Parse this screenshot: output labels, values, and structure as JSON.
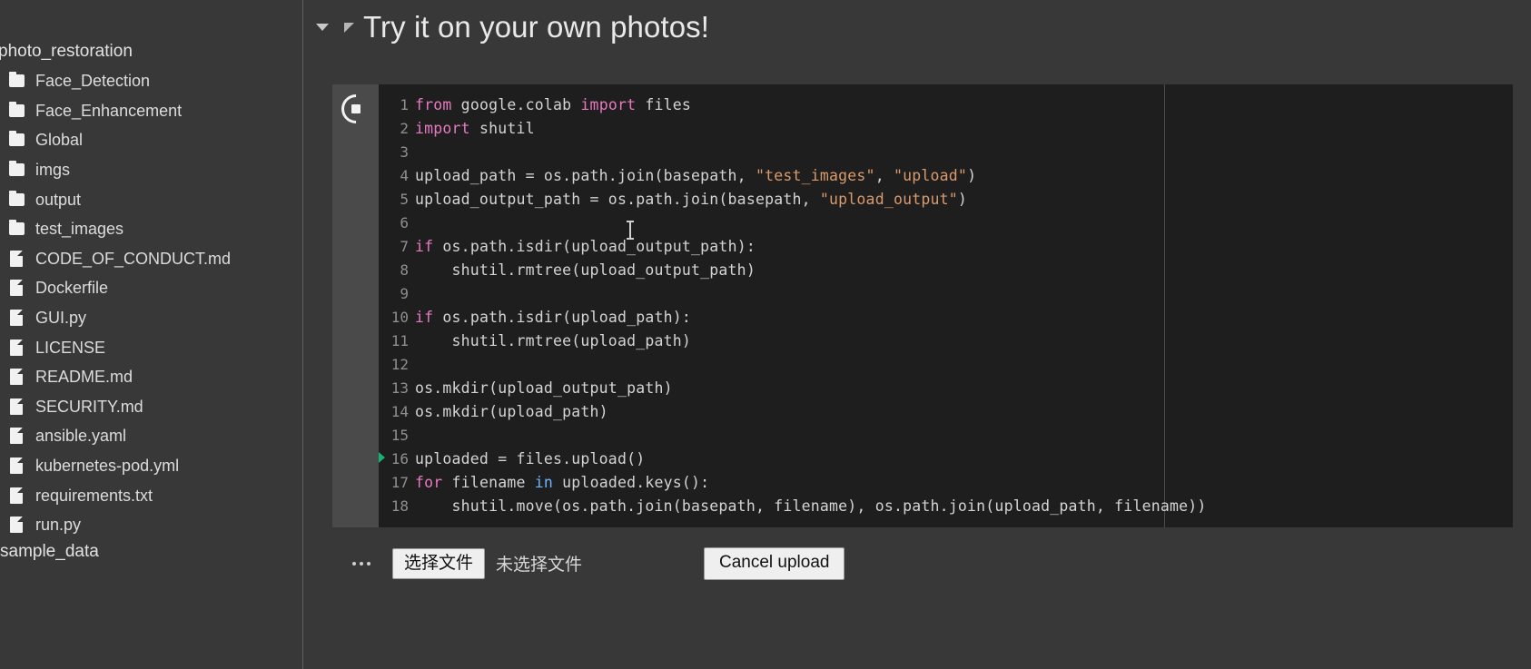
{
  "sidebar": {
    "root_label": "photo_restoration",
    "root_icon": "folder-icon",
    "items": [
      {
        "name": "Face_Detection",
        "type": "folder"
      },
      {
        "name": "Face_Enhancement",
        "type": "folder"
      },
      {
        "name": "Global",
        "type": "folder"
      },
      {
        "name": "imgs",
        "type": "folder"
      },
      {
        "name": "output",
        "type": "folder"
      },
      {
        "name": "test_images",
        "type": "folder"
      },
      {
        "name": "CODE_OF_CONDUCT.md",
        "type": "file"
      },
      {
        "name": "Dockerfile",
        "type": "file"
      },
      {
        "name": "GUI.py",
        "type": "file"
      },
      {
        "name": "LICENSE",
        "type": "file"
      },
      {
        "name": "README.md",
        "type": "file"
      },
      {
        "name": "SECURITY.md",
        "type": "file"
      },
      {
        "name": "ansible.yaml",
        "type": "file"
      },
      {
        "name": "kubernetes-pod.yml",
        "type": "file"
      },
      {
        "name": "requirements.txt",
        "type": "file"
      },
      {
        "name": "run.py",
        "type": "file"
      }
    ],
    "footer_label": "sample_data"
  },
  "notebook": {
    "section_title": "Try it on your own photos!",
    "collapse_icon": "chevron-down-icon",
    "section_marker_icon": "section-triangle-icon",
    "cell": {
      "status_icon": "running-spinner-stop-icon",
      "executing_line": 16,
      "lines": [
        {
          "n": 1,
          "tokens": [
            {
              "t": "from",
              "c": "kw"
            },
            {
              "t": " google.colab ",
              "c": "plain"
            },
            {
              "t": "import",
              "c": "kw"
            },
            {
              "t": " files",
              "c": "plain"
            }
          ]
        },
        {
          "n": 2,
          "tokens": [
            {
              "t": "import",
              "c": "kw"
            },
            {
              "t": " shutil",
              "c": "plain"
            }
          ]
        },
        {
          "n": 3,
          "tokens": [
            {
              "t": "",
              "c": "plain"
            }
          ]
        },
        {
          "n": 4,
          "tokens": [
            {
              "t": "upload_path = os.path.join(basepath, ",
              "c": "plain"
            },
            {
              "t": "\"test_images\"",
              "c": "str"
            },
            {
              "t": ", ",
              "c": "plain"
            },
            {
              "t": "\"upload\"",
              "c": "str"
            },
            {
              "t": ")",
              "c": "plain"
            }
          ]
        },
        {
          "n": 5,
          "tokens": [
            {
              "t": "upload_output_path = os.path.join(basepath, ",
              "c": "plain"
            },
            {
              "t": "\"upload_output\"",
              "c": "str"
            },
            {
              "t": ")",
              "c": "plain"
            }
          ]
        },
        {
          "n": 6,
          "tokens": [
            {
              "t": "",
              "c": "plain"
            }
          ]
        },
        {
          "n": 7,
          "tokens": [
            {
              "t": "if",
              "c": "kw"
            },
            {
              "t": " os.path.isdir(upload_output_path):",
              "c": "plain"
            }
          ]
        },
        {
          "n": 8,
          "tokens": [
            {
              "t": "    shutil.rmtree(upload_output_path)",
              "c": "plain"
            }
          ]
        },
        {
          "n": 9,
          "tokens": [
            {
              "t": "",
              "c": "plain"
            }
          ]
        },
        {
          "n": 10,
          "tokens": [
            {
              "t": "if",
              "c": "kw"
            },
            {
              "t": " os.path.isdir(upload_path):",
              "c": "plain"
            }
          ]
        },
        {
          "n": 11,
          "tokens": [
            {
              "t": "    shutil.rmtree(upload_path)",
              "c": "plain"
            }
          ]
        },
        {
          "n": 12,
          "tokens": [
            {
              "t": "",
              "c": "plain"
            }
          ]
        },
        {
          "n": 13,
          "tokens": [
            {
              "t": "os.mkdir(upload_output_path)",
              "c": "plain"
            }
          ]
        },
        {
          "n": 14,
          "tokens": [
            {
              "t": "os.mkdir(upload_path)",
              "c": "plain"
            }
          ]
        },
        {
          "n": 15,
          "tokens": [
            {
              "t": "",
              "c": "plain"
            }
          ]
        },
        {
          "n": 16,
          "tokens": [
            {
              "t": "uploaded = files.upload()",
              "c": "plain"
            }
          ]
        },
        {
          "n": 17,
          "tokens": [
            {
              "t": "for",
              "c": "kw"
            },
            {
              "t": " filename ",
              "c": "plain"
            },
            {
              "t": "in",
              "c": "kw2"
            },
            {
              "t": " uploaded.keys():",
              "c": "plain"
            }
          ]
        },
        {
          "n": 18,
          "tokens": [
            {
              "t": "    shutil.move(os.path.join(basepath, filename), os.path.join(upload_path, filename))",
              "c": "plain"
            }
          ]
        }
      ]
    },
    "output": {
      "more_menu_icon": "ellipsis-icon",
      "choose_file_label": "选择文件",
      "no_file_label": "未选择文件",
      "cancel_upload_label": "Cancel upload"
    }
  },
  "colors": {
    "sidebar_bg": "#383838",
    "code_bg": "#1e1e1e",
    "gutter_bg": "#4a4a4a",
    "keyword": "#e879c0",
    "keyword_alt": "#6cb6ff",
    "string": "#d99a6c",
    "plain_text": "#d4d4d4",
    "exec_arrow": "#15b371",
    "title_text": "#e9e9e9"
  }
}
